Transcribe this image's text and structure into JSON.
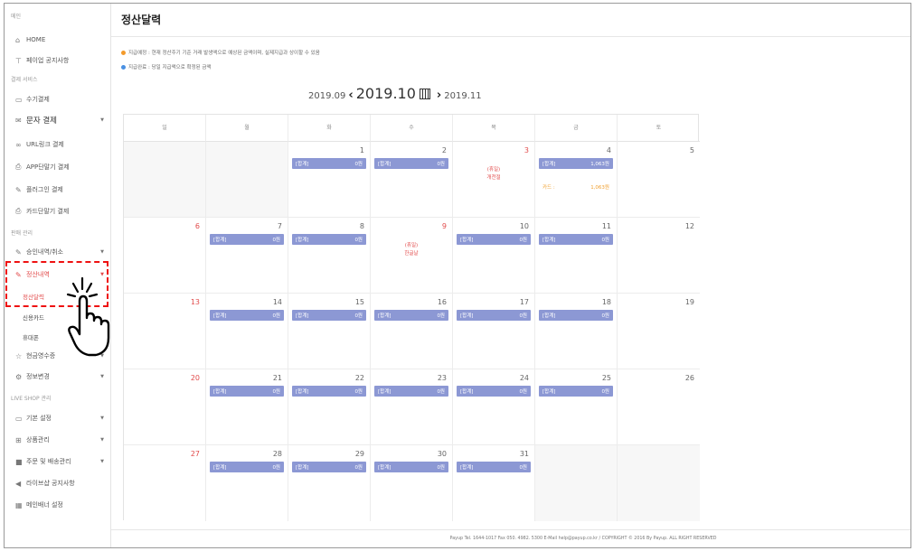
{
  "sidebar": {
    "section_main": "메인",
    "home": "HOME",
    "notice": "페이업 공지사항",
    "section_pay": "결제 서비스",
    "manual_pay": "수기결제",
    "sms_pay": "문자 결제",
    "url_pay": "URL링크 결제",
    "app_pay": "APP단말기 결제",
    "plugin_pay": "플러그인 결제",
    "card_terminal": "카드단말기 결제",
    "section_sales": "판매 관리",
    "approval": "승인내역/취소",
    "settlement": "정산내역",
    "settlement_calendar": "정산달력",
    "credit_card": "신용카드",
    "mobile": "휴대폰",
    "cash_receipt": "현금영수증",
    "info_change": "정보변경",
    "section_liveshop": "LIVE SHOP 관리",
    "basic_settings": "기본 설정",
    "product_mgmt": "상품관리",
    "order_shipping": "주문 및 배송관리",
    "liveshop_notice": "라이브샵 공지사항",
    "main_banner": "메인배너 설정"
  },
  "page": {
    "title": "정산달력",
    "legend_expected": "지급예정 : 현재 정산주기 기준 거래 발생액으로 예상된 금액이며, 실제지급과 상이할 수 있음",
    "legend_done": "지급완료 : 당일 지급액으로 확정된 금액",
    "prev_month": "2019.09",
    "current_month": "2019.10",
    "next_month": "2019.11",
    "footer": "Payup Tel. 1644-1017 Fax 050. 4982. 5300 E-Mail help@payup.co.kr / COPYRIGHT © 2016 By Payup. ALL RIGHT RESERVED"
  },
  "calendar": {
    "weekdays": [
      "일",
      "월",
      "화",
      "수",
      "목",
      "금",
      "토"
    ],
    "badge_label": "[합계]",
    "card_label": "카드 :",
    "days": [
      {
        "d": "1",
        "amt": "0원"
      },
      {
        "d": "2",
        "amt": "0원"
      },
      {
        "d": "3",
        "holiday": "(휴일)",
        "holiday_name": "개천절"
      },
      {
        "d": "4",
        "amt": "1,063원",
        "card": "1,063원"
      },
      {
        "d": "5"
      },
      {
        "d": "6"
      },
      {
        "d": "7",
        "amt": "0원"
      },
      {
        "d": "8",
        "amt": "0원"
      },
      {
        "d": "9",
        "holiday": "(휴일)",
        "holiday_name": "한글날"
      },
      {
        "d": "10",
        "amt": "0원"
      },
      {
        "d": "11",
        "amt": "0원"
      },
      {
        "d": "12"
      },
      {
        "d": "13"
      },
      {
        "d": "14",
        "amt": "0원"
      },
      {
        "d": "15",
        "amt": "0원"
      },
      {
        "d": "16",
        "amt": "0원"
      },
      {
        "d": "17",
        "amt": "0원"
      },
      {
        "d": "18",
        "amt": "0원"
      },
      {
        "d": "19"
      },
      {
        "d": "20"
      },
      {
        "d": "21",
        "amt": "0원"
      },
      {
        "d": "22",
        "amt": "0원"
      },
      {
        "d": "23",
        "amt": "0원"
      },
      {
        "d": "24",
        "amt": "0원"
      },
      {
        "d": "25",
        "amt": "0원"
      },
      {
        "d": "26"
      },
      {
        "d": "27"
      },
      {
        "d": "28",
        "amt": "0원"
      },
      {
        "d": "29",
        "amt": "0원"
      },
      {
        "d": "30",
        "amt": "0원"
      },
      {
        "d": "31",
        "amt": "0원"
      }
    ]
  },
  "colors": {
    "accent_red": "#e24b4b",
    "badge_blue": "#8c98d4",
    "legend_orange": "#f39a2b",
    "legend_blue": "#4a90e2"
  }
}
